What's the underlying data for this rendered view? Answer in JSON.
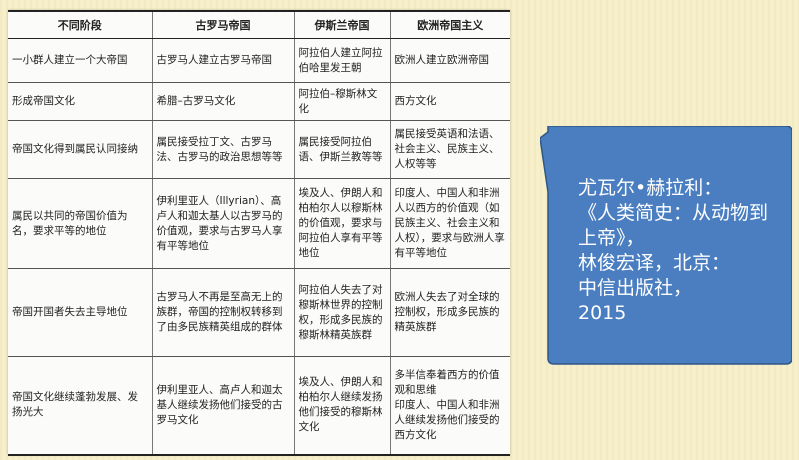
{
  "table": {
    "headers": [
      "不同阶段",
      "古罗马帝国",
      "伊斯兰帝国",
      "欧洲帝国主义"
    ],
    "rows": [
      [
        "一小群人建立一个大帝国",
        "古罗马人建立古罗马帝国",
        "阿拉伯人建立阿拉伯哈里发王朝",
        "欧洲人建立欧洲帝国"
      ],
      [
        "形成帝国文化",
        "希腊–古罗马文化",
        "阿拉伯–穆斯林文化",
        "西方文化"
      ],
      [
        "帝国文化得到属民认同接纳",
        "属民接受拉丁文、古罗马法、古罗马的政治思想等等",
        "属民接受阿拉伯语、伊斯兰教等等",
        "属民接受英语和法语、社会主义、民族主义、人权等等"
      ],
      [
        "属民以共同的帝国价值为名，要求平等的地位",
        "伊利里亚人（Illyrian）、高卢人和迦太基人以古罗马的价值观，要求与古罗马人享有平等地位",
        "埃及人、伊朗人和柏柏尔人以穆斯林的价值观，要求与阿拉伯人享有平等地位",
        "印度人、中国人和非洲人以西方的价值观（如民族主义、社会主义和人权），要求与欧洲人享有平等地位"
      ],
      [
        "帝国开国者失去主导地位",
        "古罗马人不再是至高无上的族群，帝国的控制权转移到了由多民族精英组成的群体",
        "阿拉伯人失去了对穆斯林世界的控制权，形成多民族的穆斯林精英族群",
        "欧洲人失去了对全球的控制权，形成多民族的精英族群"
      ],
      [
        "帝国文化继续蓬勃发展、发扬光大",
        "伊利里亚人、高卢人和迦太基人继续发扬他们接受的古罗马文化",
        "埃及人、伊朗人和柏柏尔人继续发扬他们接受的穆斯林文化",
        "多半信奉着西方的价值观和思维\n印度人、中国人和非洲人继续发扬他们接受的西方文化"
      ]
    ]
  },
  "callout": {
    "text": "尤瓦尔•赫拉利：\n《人类简史：从动物到上帝》，\n林俊宏译，北京：\n中信出版社，\n2015",
    "fill_color": "#4a7ec0",
    "border_color": "#2f5786"
  }
}
